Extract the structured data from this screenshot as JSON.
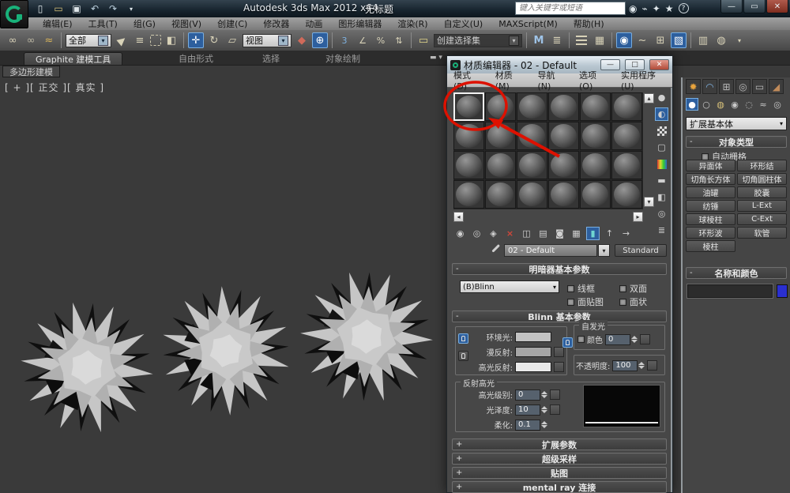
{
  "colors": {
    "accent_blue": "#2d5f9e",
    "annotation_red": "#dd1100",
    "object_color_swatch": "#2a2fd0",
    "viewport_bg": "#3a3a3a"
  },
  "titlebar": {
    "app_title": "Autodesk 3ds Max 2012 x64",
    "doc_title": "无标题",
    "search_placeholder": "键入关键字或短语"
  },
  "menubar": {
    "items": [
      "编辑(E)",
      "工具(T)",
      "组(G)",
      "视图(V)",
      "创建(C)",
      "修改器",
      "动画",
      "图形编辑器",
      "渲染(R)",
      "自定义(U)",
      "MAXScript(M)",
      "帮助(H)"
    ]
  },
  "toolbar": {
    "selection_filter": "全部",
    "reference_coord": "视图",
    "named_selection": "创建选择集",
    "snap_3d": "3",
    "snap_angle": "∠",
    "snap_percent": "%"
  },
  "ribbon": {
    "tab_main": "Graphite 建模工具",
    "tab_freeform": "自由形式",
    "tab_selection": "选择",
    "tab_paint": "对象绘制",
    "subtab": "多边形建模"
  },
  "viewport": {
    "label": "[ + ][ 正交 ][ 真实 ]"
  },
  "material_editor": {
    "title": "材质编辑器 - 02 - Default",
    "menu": [
      "模式(D)",
      "材质(M)",
      "导航(N)",
      "选项(O)",
      "实用程序(U)"
    ],
    "material_name": "02 - Default",
    "material_type": "Standard",
    "shader_rollout": {
      "title": "明暗器基本参数",
      "shader": "(B)Blinn",
      "cb_wire": "线框",
      "cb_2side": "双面",
      "cb_facemap": "面贴图",
      "cb_faceted": "面状"
    },
    "blinn_rollout": {
      "title": "Blinn 基本参数",
      "ambient": "环境光:",
      "diffuse": "漫反射:",
      "specular": "高光反射:",
      "selfillum_title": "自发光",
      "selfillum_color": "颜色",
      "selfillum_value": "0",
      "opacity_label": "不透明度:",
      "opacity_value": "100"
    },
    "highlight_group": {
      "title": "反射高光",
      "level_label": "高光级别:",
      "level_value": "0",
      "gloss_label": "光泽度:",
      "gloss_value": "10",
      "soften_label": "柔化:",
      "soften_value": "0.1"
    },
    "rollout_extended": "扩展参数",
    "rollout_supersampling": "超级采样",
    "rollout_maps": "贴图",
    "rollout_mentalray": "mental ray 连接"
  },
  "command_panel": {
    "category": "扩展基本体",
    "object_type_title": "对象类型",
    "autogrid": "自动栅格",
    "buttons": [
      "异面体",
      "环形结",
      "切角长方体",
      "切角圆柱体",
      "油罐",
      "胶囊",
      "纺锤",
      "L-Ext",
      "球棱柱",
      "C-Ext",
      "环形波",
      "软管",
      "棱柱"
    ],
    "name_color_title": "名称和颜色"
  }
}
